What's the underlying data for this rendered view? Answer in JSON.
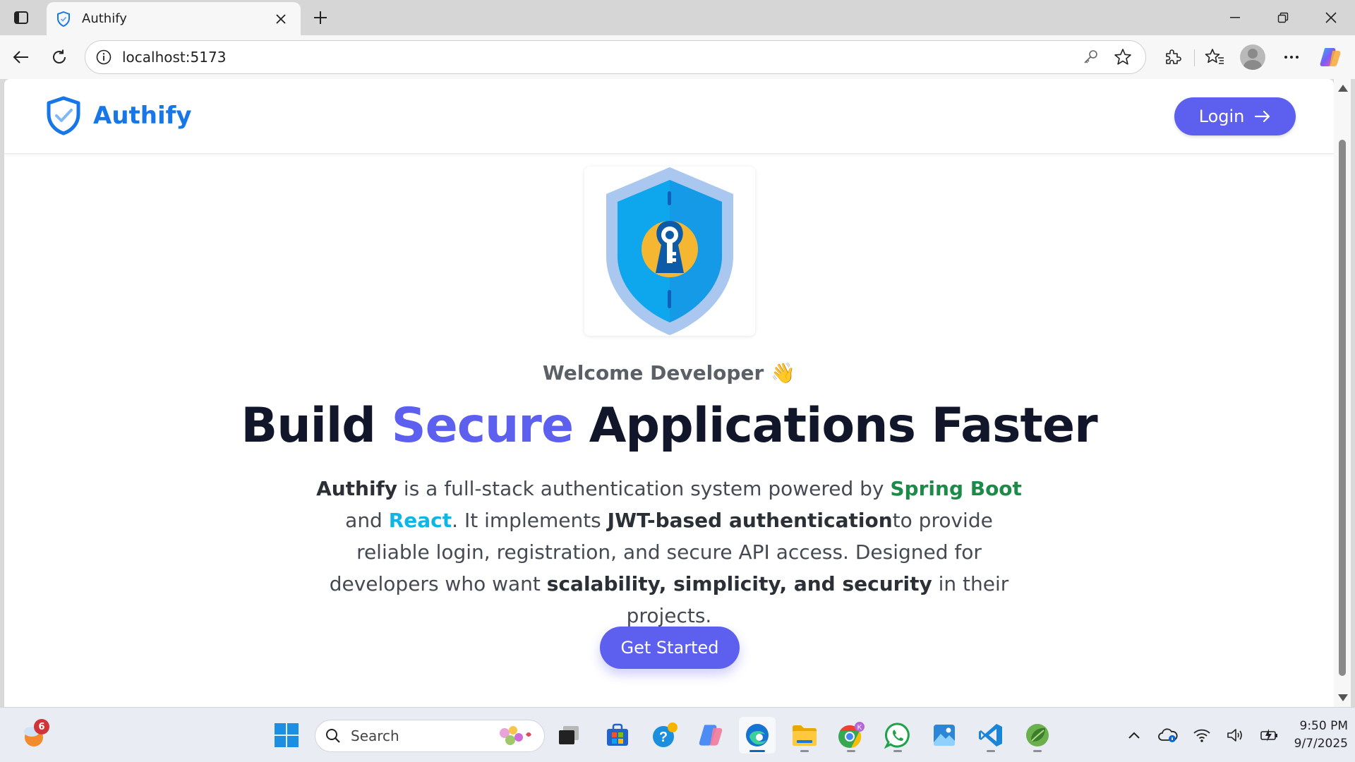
{
  "browser": {
    "tab_title": "Authify",
    "address": "localhost:5173"
  },
  "site": {
    "brand_name": "Authify",
    "login_label": "Login",
    "welcome": "Welcome Developer",
    "wave_emoji": "👋",
    "title_part1": "Build ",
    "title_accent": "Secure",
    "title_part2": " Applications Faster",
    "desc": {
      "brand": "Authify",
      "t1": " is a full-stack authentication system powered by ",
      "spring": "Spring Boot",
      "t2": " and ",
      "react": "React",
      "t3": ". It implements ",
      "jwt": "JWT-based authentication",
      "t4": "to provide reliable login, registration, and secure API access. Designed for developers who want ",
      "qualities": "scalability, simplicity, and security",
      "t5": " in their projects."
    },
    "cta_label": "Get Started"
  },
  "taskbar": {
    "weather_badge": "6",
    "search_placeholder": "Search",
    "time": "9:50 PM",
    "date": "9/7/2025"
  },
  "colors": {
    "brand_blue": "#1877e8",
    "accent_purple": "#5d5fef",
    "spring_green": "#1e8a4a",
    "react_cyan": "#11b5e4",
    "title_dark": "#12162a"
  },
  "icons": {
    "tab_favicon": "shield-check-icon",
    "hero_image": "shield-keyhole-icon",
    "login_arrow": "arrow-right-icon"
  }
}
